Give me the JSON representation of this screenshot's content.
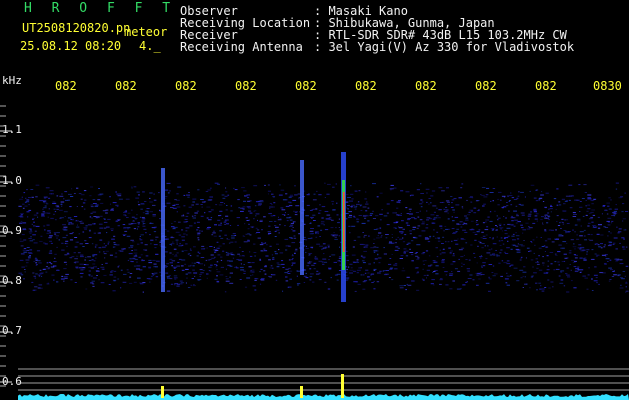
{
  "header": {
    "title": "H R O F F T",
    "filename": "UT2508120820.pn",
    "meteor_label": "meteor",
    "datetime": "25.08.12 08:20",
    "count": "4._",
    "observer_label": "Observer",
    "observer_value": ": Masaki Kano",
    "location_label": "Receiving Location",
    "location_value": ": Shibukawa, Gunma, Japan",
    "receiver_label": "Receiver",
    "receiver_value": ": RTL-SDR SDR# 43dB L15 103.2MHz CW",
    "antenna_label": "Receiving Antenna",
    "antenna_value": ": 3el Yagi(V) Az 330 for Vladivostok"
  },
  "axis": {
    "unit": "kHz",
    "y_ticks": [
      "1.1",
      "1.0",
      "0.9",
      "0.8",
      "0.7",
      "0.6"
    ],
    "time_ticks": [
      "082",
      "082",
      "082",
      "082",
      "082",
      "082",
      "082",
      "082",
      "082",
      "0830"
    ]
  },
  "colors": {
    "background": "#000000",
    "text_white": "#f2f2f2",
    "text_yellow": "#ffff33",
    "title_green": "#33dd66",
    "noise_blue": "#1a1aa0",
    "echo_core": "#ff4040",
    "baseline_cyan": "#33e0ff",
    "grid_line": "#c8c8c8"
  }
}
